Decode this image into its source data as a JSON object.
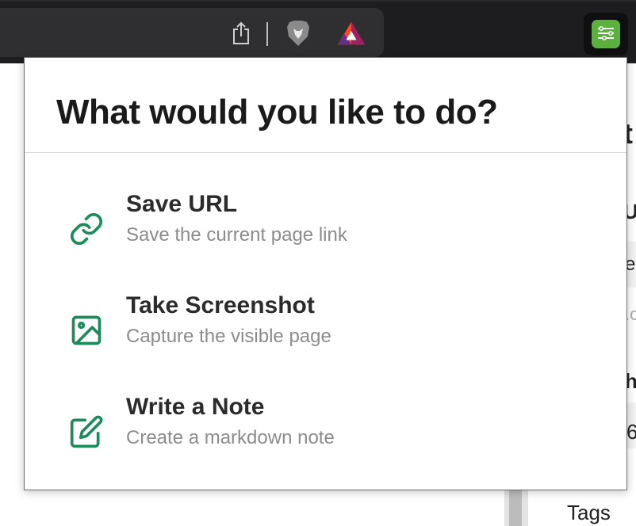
{
  "browser": {
    "share_icon": "share-icon",
    "brave_icon": "brave-lion-icon",
    "bat_icon": "bat-rewards-icon",
    "extension_icon": "note-extension-icon"
  },
  "background": {
    "fragments": [
      "t",
      "Ur",
      "er",
      ".c",
      "h",
      "6"
    ],
    "tags_label": "Tags"
  },
  "popup": {
    "title": "What would you like to do?",
    "actions": [
      {
        "title": "Save URL",
        "subtitle": "Save the current page link",
        "icon": "link-icon"
      },
      {
        "title": "Take Screenshot",
        "subtitle": "Capture the visible page",
        "icon": "image-icon"
      },
      {
        "title": "Write a Note",
        "subtitle": "Create a markdown note",
        "icon": "edit-note-icon"
      }
    ]
  },
  "colors": {
    "accent_green": "#1c8a5a",
    "extension_green": "#5cb03d",
    "chrome_bg": "#1d1d1f"
  }
}
